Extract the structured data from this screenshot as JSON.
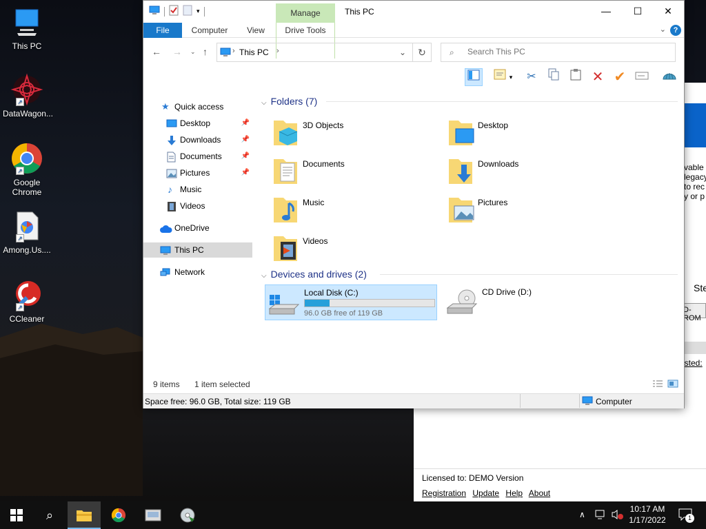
{
  "desktop": {
    "icons": [
      {
        "label": "This PC"
      },
      {
        "label": "DataWagon..."
      },
      {
        "label": "Google Chrome"
      },
      {
        "label": "Among.Us...."
      },
      {
        "label": "CCleaner"
      }
    ]
  },
  "background_window": {
    "text_lines": [
      "vable",
      "legacy",
      "to rec",
      "y or p"
    ],
    "heading_fragment": "Ste",
    "field_fragment": "D-ROM",
    "link_fragment": "isted:",
    "license_text": "Licensed to: DEMO Version",
    "links": [
      "Registration",
      "Update",
      "Help",
      "About"
    ]
  },
  "explorer": {
    "title": "This PC",
    "contextual_tab": "Manage",
    "ribbon_tabs": [
      "File",
      "Computer",
      "View",
      "Drive Tools"
    ],
    "address": {
      "crumb": "This PC"
    },
    "search": {
      "placeholder": "Search This PC"
    },
    "nav": {
      "quick_access": "Quick access",
      "items": [
        {
          "label": "Desktop",
          "pinned": true
        },
        {
          "label": "Downloads",
          "pinned": true
        },
        {
          "label": "Documents",
          "pinned": true
        },
        {
          "label": "Pictures",
          "pinned": true
        },
        {
          "label": "Music",
          "pinned": false
        },
        {
          "label": "Videos",
          "pinned": false
        }
      ],
      "onedrive": "OneDrive",
      "this_pc": "This PC",
      "network": "Network"
    },
    "folders_header": "Folders (7)",
    "folders": [
      {
        "name": "3D Objects"
      },
      {
        "name": "Desktop"
      },
      {
        "name": "Documents"
      },
      {
        "name": "Downloads"
      },
      {
        "name": "Music"
      },
      {
        "name": "Pictures"
      },
      {
        "name": "Videos"
      }
    ],
    "drives_header": "Devices and drives (2)",
    "drives": [
      {
        "name": "Local Disk (C:)",
        "free_text": "96.0 GB free of 119 GB",
        "used_fraction": 0.193
      },
      {
        "name": "CD Drive (D:)"
      }
    ],
    "status": {
      "items": "9 items",
      "selected": "1 item selected"
    },
    "bottom": {
      "space": "Space free: 96.0 GB, Total size: 119 GB",
      "location": "Computer"
    }
  },
  "taskbar": {
    "time": "10:17 AM",
    "date": "1/17/2022",
    "notifications": "1"
  }
}
